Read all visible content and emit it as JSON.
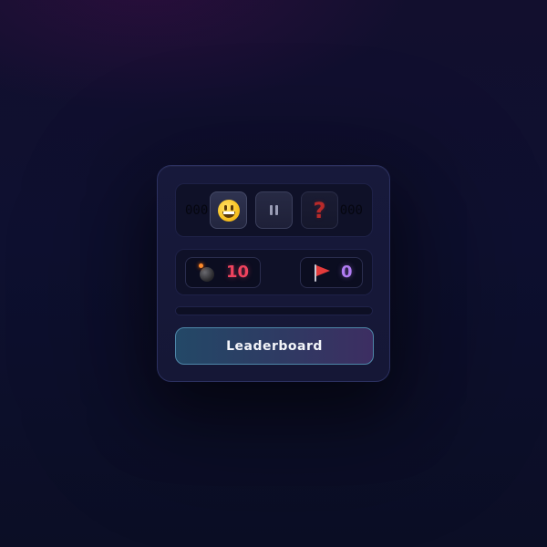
{
  "game": {
    "timer_left": "000",
    "timer_right": "000",
    "face_button": {
      "icon": "smiley-face-icon"
    },
    "pause_button": {
      "icon": "pause-icon"
    },
    "help_button": {
      "icon": "question-mark-icon",
      "glyph": "?"
    }
  },
  "counters": {
    "mines": {
      "icon": "bomb-icon",
      "value": "10"
    },
    "flags": {
      "icon": "flag-icon",
      "value": "0"
    }
  },
  "progress": {
    "value": 0
  },
  "leaderboard": {
    "label": "Leaderboard"
  },
  "colors": {
    "mine_count": "#f0435e",
    "flag_count": "#b17cf3",
    "help_icon": "#b82a2a",
    "button_border": "#4e86a8"
  }
}
